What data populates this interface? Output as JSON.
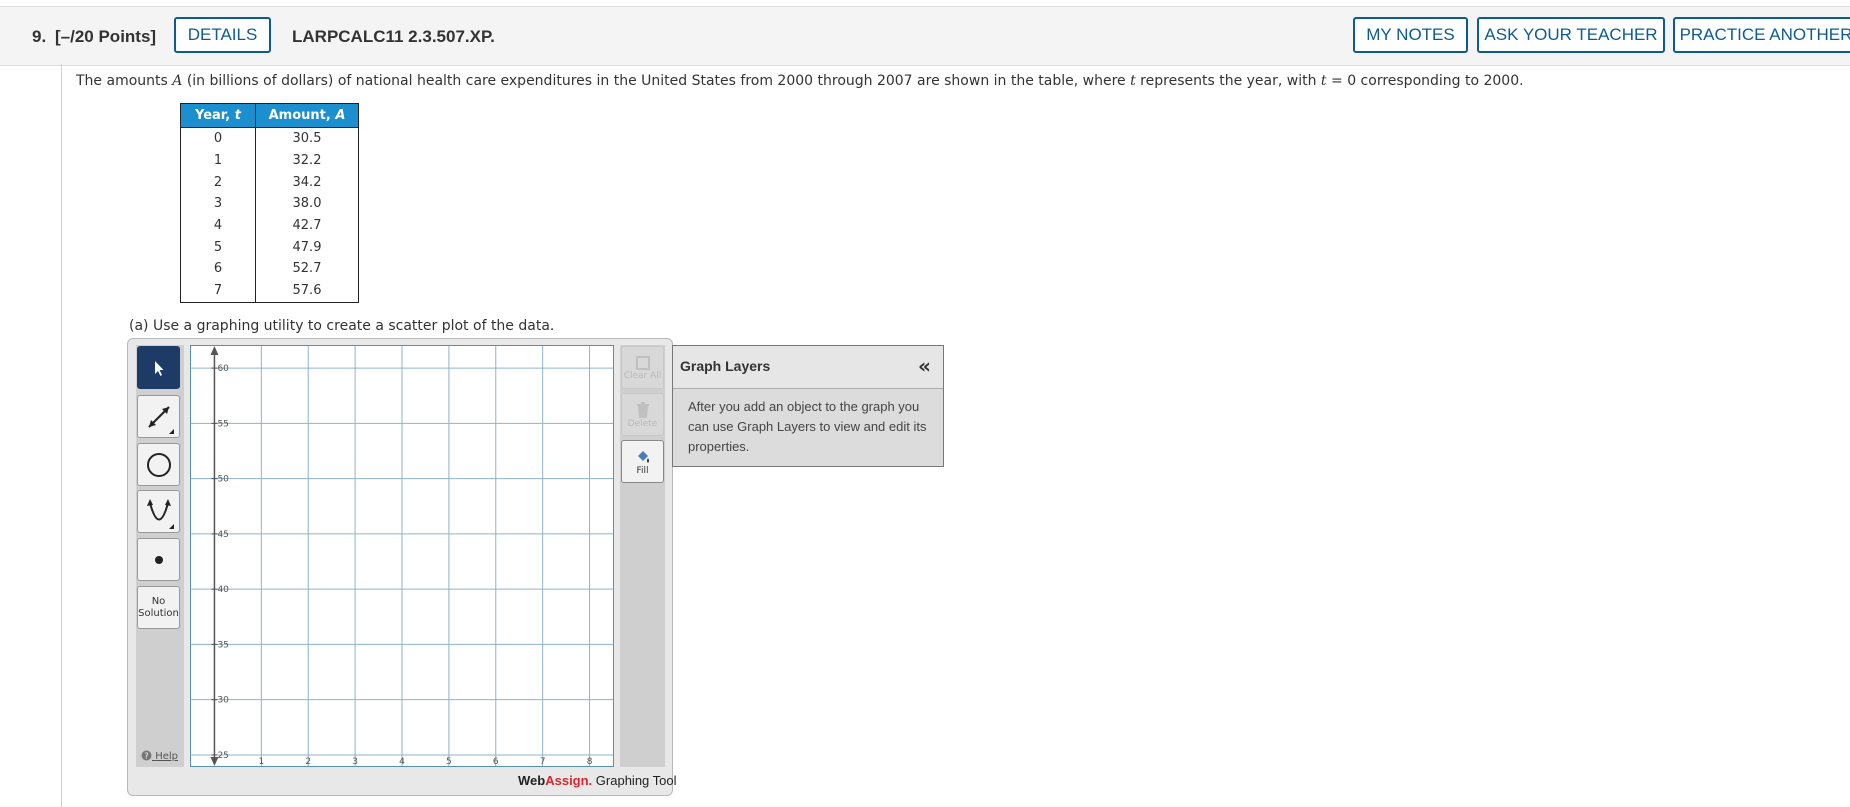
{
  "header": {
    "question_number": "9.",
    "points": "[–/20 Points]",
    "details_button": "DETAILS",
    "code": "LARPCALC11 2.3.507.XP.",
    "my_notes_button": "MY NOTES",
    "ask_teacher_button": "ASK YOUR TEACHER",
    "practice_button": "PRACTICE ANOTHER"
  },
  "prompt": {
    "part1": "The amounts ",
    "var_a": "A",
    "part2": " (in billions of dollars) of national health care expenditures in the United States from 2000 through 2007 are shown in the table, where ",
    "var_t": "t",
    "part3": " represents the year, with ",
    "var_t2": "t",
    "part4": " = 0 corresponding to 2000."
  },
  "table": {
    "header_year": "Year, ",
    "header_year_var": "t",
    "header_amount": "Amount, ",
    "header_amount_var": "A",
    "rows": [
      {
        "t": "0",
        "a": "30.5"
      },
      {
        "t": "1",
        "a": "32.2"
      },
      {
        "t": "2",
        "a": "34.2"
      },
      {
        "t": "3",
        "a": "38.0"
      },
      {
        "t": "4",
        "a": "42.7"
      },
      {
        "t": "5",
        "a": "47.9"
      },
      {
        "t": "6",
        "a": "52.7"
      },
      {
        "t": "7",
        "a": "57.6"
      }
    ]
  },
  "part_a": "(a) Use a graphing utility to create a scatter plot of the data.",
  "graph_tool": {
    "tools": [
      "pointer-icon",
      "line-icon",
      "circle-icon",
      "parabola-icon",
      "point-icon"
    ],
    "no_solution_label_1": "No",
    "no_solution_label_2": "Solution",
    "help_label": "Help",
    "clear_all_label": "Clear All",
    "delete_label": "Delete",
    "fill_label": "Fill",
    "brand_web": "Web",
    "brand_assign": "Assign.",
    "brand_tool": " Graphing Tool",
    "x_ticks": [
      "1",
      "2",
      "3",
      "4",
      "5",
      "6",
      "7",
      "8"
    ],
    "y_ticks": [
      "25",
      "30",
      "35",
      "40",
      "45",
      "50",
      "55",
      "60"
    ],
    "x_range": [
      -0.5,
      8.5
    ],
    "y_range": [
      24,
      62
    ]
  },
  "layers_panel": {
    "title": "Graph Layers",
    "collapse_glyph": "«",
    "body": "After you add an object to the graph you can use Graph Layers to view and edit its properties."
  },
  "colors": {
    "accent": "#0e5c8f",
    "table_header": "#1c8fce",
    "selected_tool": "#1d3b66",
    "brand_red": "#d9272e",
    "grid": "#8db3cc"
  }
}
